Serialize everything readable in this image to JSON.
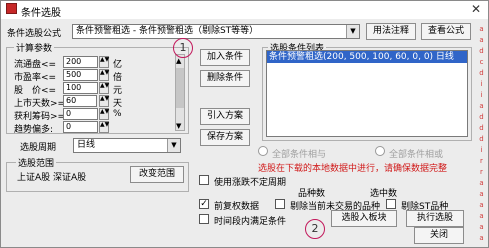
{
  "window": {
    "title": "条件选股",
    "close": "✕"
  },
  "formula": {
    "label": "条件选股公式",
    "value": "条件预警粗选 - 条件预警粗选（剔除ST等等）",
    "usage_button": "用法注释",
    "view_button": "查看公式"
  },
  "params": {
    "legend": "计算参数",
    "rows": [
      {
        "label": "流通盘<=",
        "value": "200",
        "unit": "亿"
      },
      {
        "label": "市盈率<=",
        "value": "500",
        "unit": "倍"
      },
      {
        "label": "股　价<=",
        "value": "100",
        "unit": "元"
      },
      {
        "label": "上市天数>=",
        "value": "60",
        "unit": "天"
      },
      {
        "label": "获利筹码>=",
        "value": "0",
        "unit": "%"
      },
      {
        "label": "趋势偏多:",
        "value": "0",
        "unit": ""
      }
    ]
  },
  "period": {
    "label": "选股周期",
    "value": "日线"
  },
  "range": {
    "legend": "选股范围",
    "text": "上证A股 深证A股",
    "change_button": "改变范围"
  },
  "buttons": {
    "add": "加入条件",
    "delete": "删除条件",
    "import": "引入方案",
    "save": "保存方案",
    "to_block": "选股入板块",
    "execute": "执行选股",
    "close": "关闭"
  },
  "list": {
    "legend": "选股条件列表",
    "rows": [
      "条件预警粗选(200, 500, 100, 60, 0, 0) 日线"
    ]
  },
  "logic": {
    "and": "全部条件相与",
    "or": "全部条件相或"
  },
  "note": "选股在下载的本地数据中进行，请确保数据完整",
  "options": {
    "irregular": "使用涨跌不定周期",
    "prev_rights": "前复权数据",
    "exclude_suspended": "剔除当前未交易的品种",
    "exclude_st": "剔除ST品种",
    "time_segment": "时间段内满足条件"
  },
  "counts": {
    "total_label": "品种数",
    "selected_label": "选中数"
  },
  "annotations": {
    "one": "1",
    "two": "2"
  },
  "colors": {
    "selection": "#3065c8",
    "note_red": "#d11a1a",
    "circle": "#c2185b"
  },
  "right_edge_marks": [
    "a",
    "a",
    "d",
    "c",
    "d",
    "i",
    "i",
    "a",
    "d",
    "d",
    "d",
    "i",
    "r",
    "r",
    "a",
    "a",
    "a",
    "a",
    "a",
    "a"
  ]
}
